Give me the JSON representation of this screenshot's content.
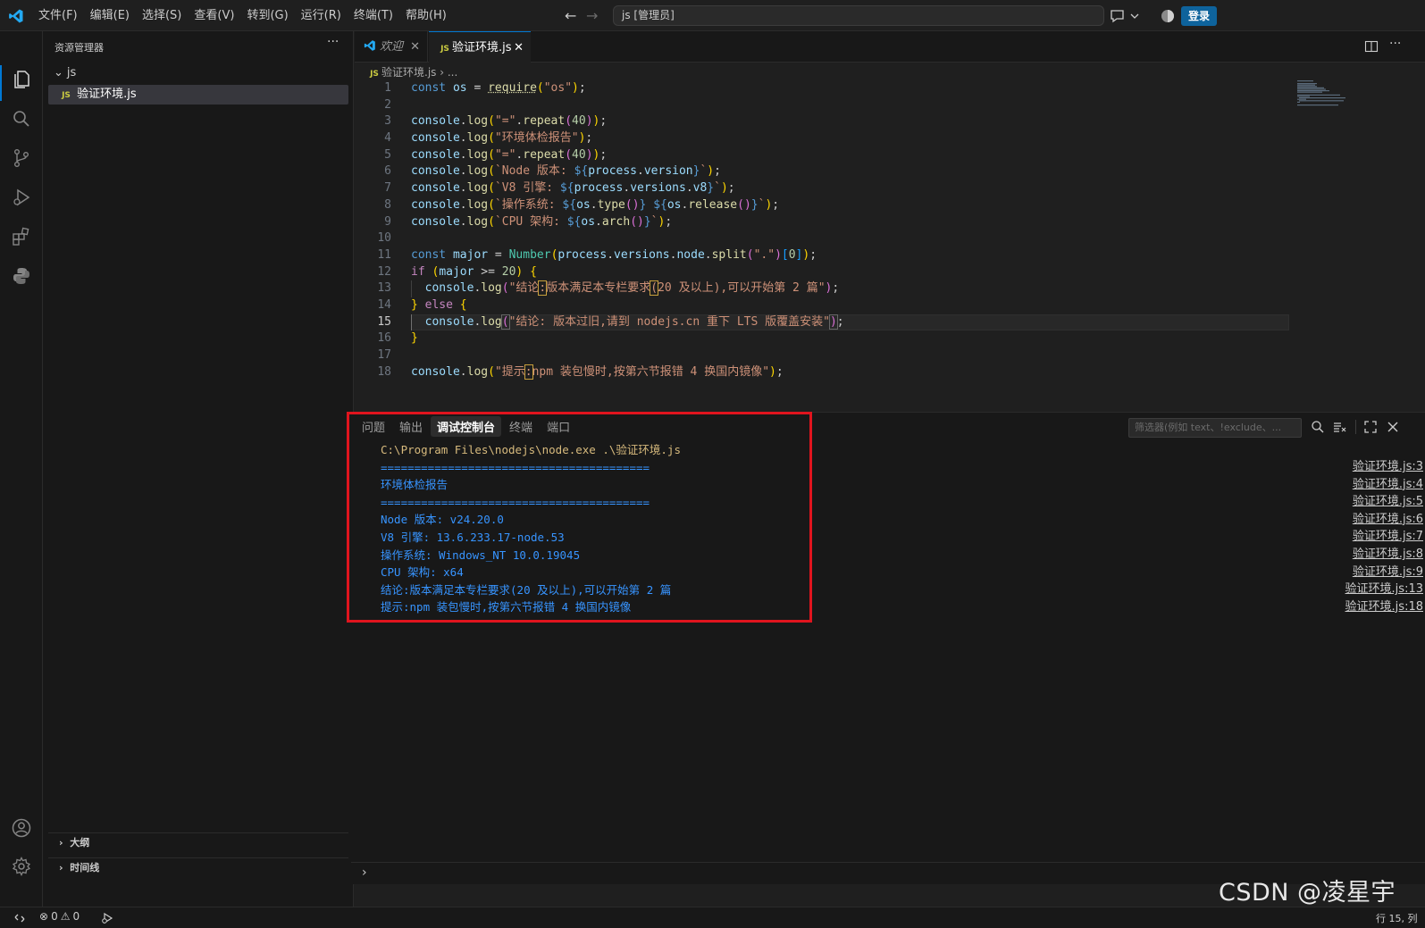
{
  "menu": [
    "文件(F)",
    "编辑(E)",
    "选择(S)",
    "查看(V)",
    "转到(G)",
    "运行(R)",
    "终端(T)",
    "帮助(H)"
  ],
  "command_center": "js [管理员]",
  "login_label": "登录",
  "sidebar": {
    "title": "资源管理器",
    "folder": "js",
    "file": "验证环境.js",
    "sections": [
      "大纲",
      "时间线"
    ]
  },
  "tabs": {
    "welcome": "欢迎",
    "file": "验证环境.js",
    "file_badge": "JS"
  },
  "breadcrumb": {
    "file": "验证环境.js",
    "more": "..."
  },
  "code_line_numbers": [
    "1",
    "2",
    "3",
    "4",
    "5",
    "6",
    "7",
    "8",
    "9",
    "10",
    "11",
    "12",
    "13",
    "14",
    "15",
    "16",
    "17",
    "18"
  ],
  "code": [
    "const os = require(\"os\");",
    "",
    "console.log(\"=\".repeat(40));",
    "console.log(\"环境体检报告\");",
    "console.log(\"=\".repeat(40));",
    "console.log(`Node 版本: ${process.version}`);",
    "console.log(`V8 引擎: ${process.versions.v8}`);",
    "console.log(`操作系统: ${os.type()} ${os.release()}`);",
    "console.log(`CPU 架构: ${os.arch()}`);",
    "",
    "const major = Number(process.versions.node.split(\".\")[0]);",
    "if (major >= 20) {",
    "  console.log(\"结论:版本满足本专栏要求(20 及以上),可以开始第 2 篇\");",
    "} else {",
    "  console.log(\"结论: 版本过旧,请到 nodejs.cn 重下 LTS 版覆盖安装\");",
    "}",
    "",
    "console.log(\"提示:npm 装包慢时,按第六节报错 4 换国内镜像\");"
  ],
  "panel": {
    "tabs": [
      "问题",
      "输出",
      "调试控制台",
      "终端",
      "端口"
    ],
    "active_tab": "调试控制台",
    "filter_placeholder": "筛选器(例如 text、!exclude、...",
    "command": "C:\\Program Files\\nodejs\\node.exe .\\验证环境.js",
    "output": [
      "========================================",
      "环境体检报告",
      "========================================",
      "Node 版本: v24.20.0",
      "V8 引擎: 13.6.233.17-node.53",
      "操作系统: Windows_NT 10.0.19045",
      "CPU 架构: x64",
      "结论:版本满足本专栏要求(20 及以上),可以开始第 2 篇",
      "提示:npm 装包慢时,按第六节报错 4 换国内镜像"
    ],
    "sources": [
      "验证环境.js:3",
      "验证环境.js:4",
      "验证环境.js:5",
      "验证环境.js:6",
      "验证环境.js:7",
      "验证环境.js:8",
      "验证环境.js:9",
      "验证环境.js:13",
      "验证环境.js:18"
    ]
  },
  "status": {
    "errors": "0",
    "warnings": "0",
    "cursor": "行 15, 列"
  },
  "watermark": "CSDN @凌星宇",
  "colors": {
    "accent": "#0078d4",
    "highlight_box": "#e0141e",
    "console_text": "#3794ff"
  }
}
